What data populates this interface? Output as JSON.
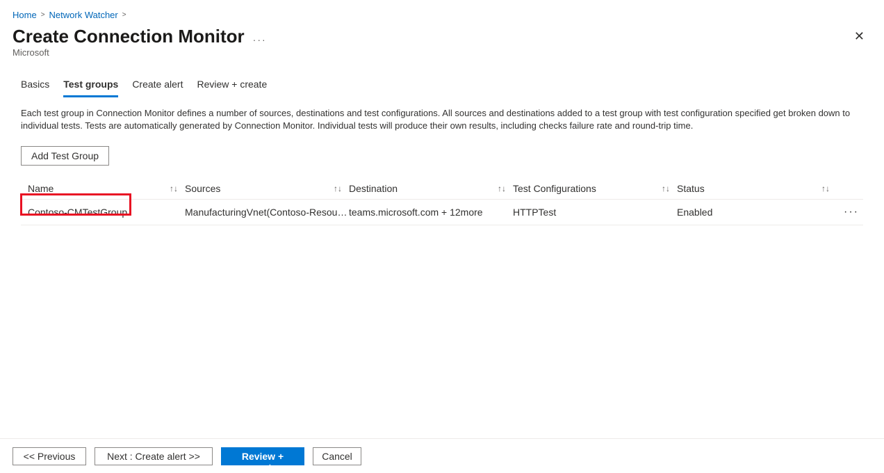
{
  "breadcrumb": {
    "home": "Home",
    "section": "Network Watcher"
  },
  "header": {
    "title": "Create Connection Monitor",
    "subtitle": "Microsoft"
  },
  "tabs": {
    "basics": "Basics",
    "test_groups": "Test groups",
    "create_alert": "Create alert",
    "review": "Review + create"
  },
  "description": "Each test group in Connection Monitor defines a number of sources, destinations and test configurations. All sources and destinations added to a test group with test configuration specified get broken down to individual tests. Tests are automatically generated by Connection Monitor. Individual tests will produce their own results, including checks failure rate and round-trip time.",
  "buttons": {
    "add_test_group": "Add Test Group",
    "previous": "<< Previous",
    "next": "Next : Create alert >>",
    "review": "Review + create",
    "cancel": "Cancel"
  },
  "table": {
    "headers": {
      "name": "Name",
      "sources": "Sources",
      "destination": "Destination",
      "test_config": "Test Configurations",
      "status": "Status"
    },
    "rows": [
      {
        "name": "Contoso-CMTestGroup",
        "sources": "ManufacturingVnet(Contoso-Resourc…",
        "destination": "teams.microsoft.com + 12more",
        "test_config": "HTTPTest",
        "status": "Enabled"
      }
    ]
  }
}
